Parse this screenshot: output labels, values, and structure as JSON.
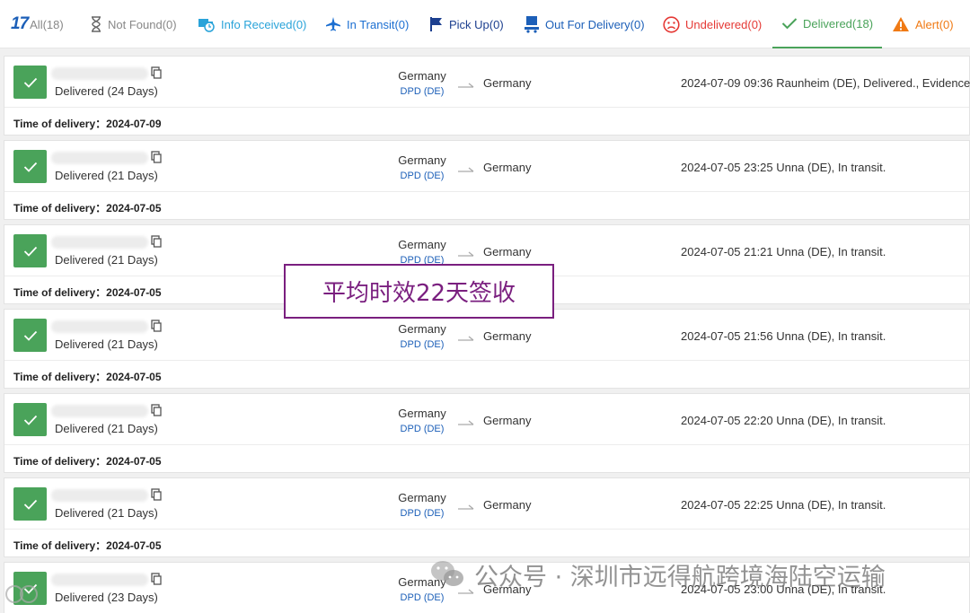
{
  "tabs": [
    {
      "label": "All(18)",
      "color": "#888888",
      "icon": "17track-logo"
    },
    {
      "label": "Not Found(0)",
      "color": "#888888",
      "icon": "hourglass-icon"
    },
    {
      "label": "Info Received(0)",
      "color": "#29a3d9",
      "icon": "truck-clock-icon"
    },
    {
      "label": "In Transit(0)",
      "color": "#1c6fd1",
      "icon": "plane-icon"
    },
    {
      "label": "Pick Up(0)",
      "color": "#1c3f8f",
      "icon": "flag-icon"
    },
    {
      "label": "Out For Delivery(0)",
      "color": "#1c5fb8",
      "icon": "delivery-person-icon"
    },
    {
      "label": "Undelivered(0)",
      "color": "#e53935",
      "icon": "sad-face-icon"
    },
    {
      "label": "Delivered(18)",
      "color": "#4aa35a",
      "icon": "check-icon"
    },
    {
      "label": "Alert(0)",
      "color": "#f07a14",
      "icon": "warning-icon"
    }
  ],
  "logo_text": "17",
  "colors": {
    "delivered_green": "#4aa35a",
    "carrier_blue": "#1c5fb8",
    "annotation_purple": "#7a1f7f"
  },
  "shipments": [
    {
      "status": "Delivered (24 Days)",
      "origin": "Germany",
      "carrier": "DPD (DE)",
      "destination": "Germany",
      "event": "2024-07-09 09:36  Raunheim (DE), Delivered., Evidence",
      "delivery": "Time of delivery：2024-07-09"
    },
    {
      "status": "Delivered (21 Days)",
      "origin": "Germany",
      "carrier": "DPD (DE)",
      "destination": "Germany",
      "event": "2024-07-05 23:25  Unna (DE), In transit.",
      "delivery": "Time of delivery：2024-07-05"
    },
    {
      "status": "Delivered (21 Days)",
      "origin": "Germany",
      "carrier": "DPD (DE)",
      "destination": "Germany",
      "event": "2024-07-05 21:21  Unna (DE), In transit.",
      "delivery": "Time of delivery：2024-07-05"
    },
    {
      "status": "Delivered (21 Days)",
      "origin": "Germany",
      "carrier": "DPD (DE)",
      "destination": "Germany",
      "event": "2024-07-05 21:56  Unna (DE), In transit.",
      "delivery": "Time of delivery：2024-07-05"
    },
    {
      "status": "Delivered (21 Days)",
      "origin": "Germany",
      "carrier": "DPD (DE)",
      "destination": "Germany",
      "event": "2024-07-05 22:20  Unna (DE), In transit.",
      "delivery": "Time of delivery：2024-07-05"
    },
    {
      "status": "Delivered (21 Days)",
      "origin": "Germany",
      "carrier": "DPD (DE)",
      "destination": "Germany",
      "event": "2024-07-05 22:25  Unna (DE), In transit.",
      "delivery": "Time of delivery：2024-07-05"
    },
    {
      "status": "Delivered (23 Days)",
      "origin": "Germany",
      "carrier": "DPD (DE)",
      "destination": "Germany",
      "event": "2024-07-05 23:00  Unna (DE), In transit.",
      "delivery": ""
    }
  ],
  "annotation": {
    "text": "平均时效22天签收"
  },
  "watermark": {
    "text": "公众号 · 深圳市远得航跨境海陆空运输"
  }
}
